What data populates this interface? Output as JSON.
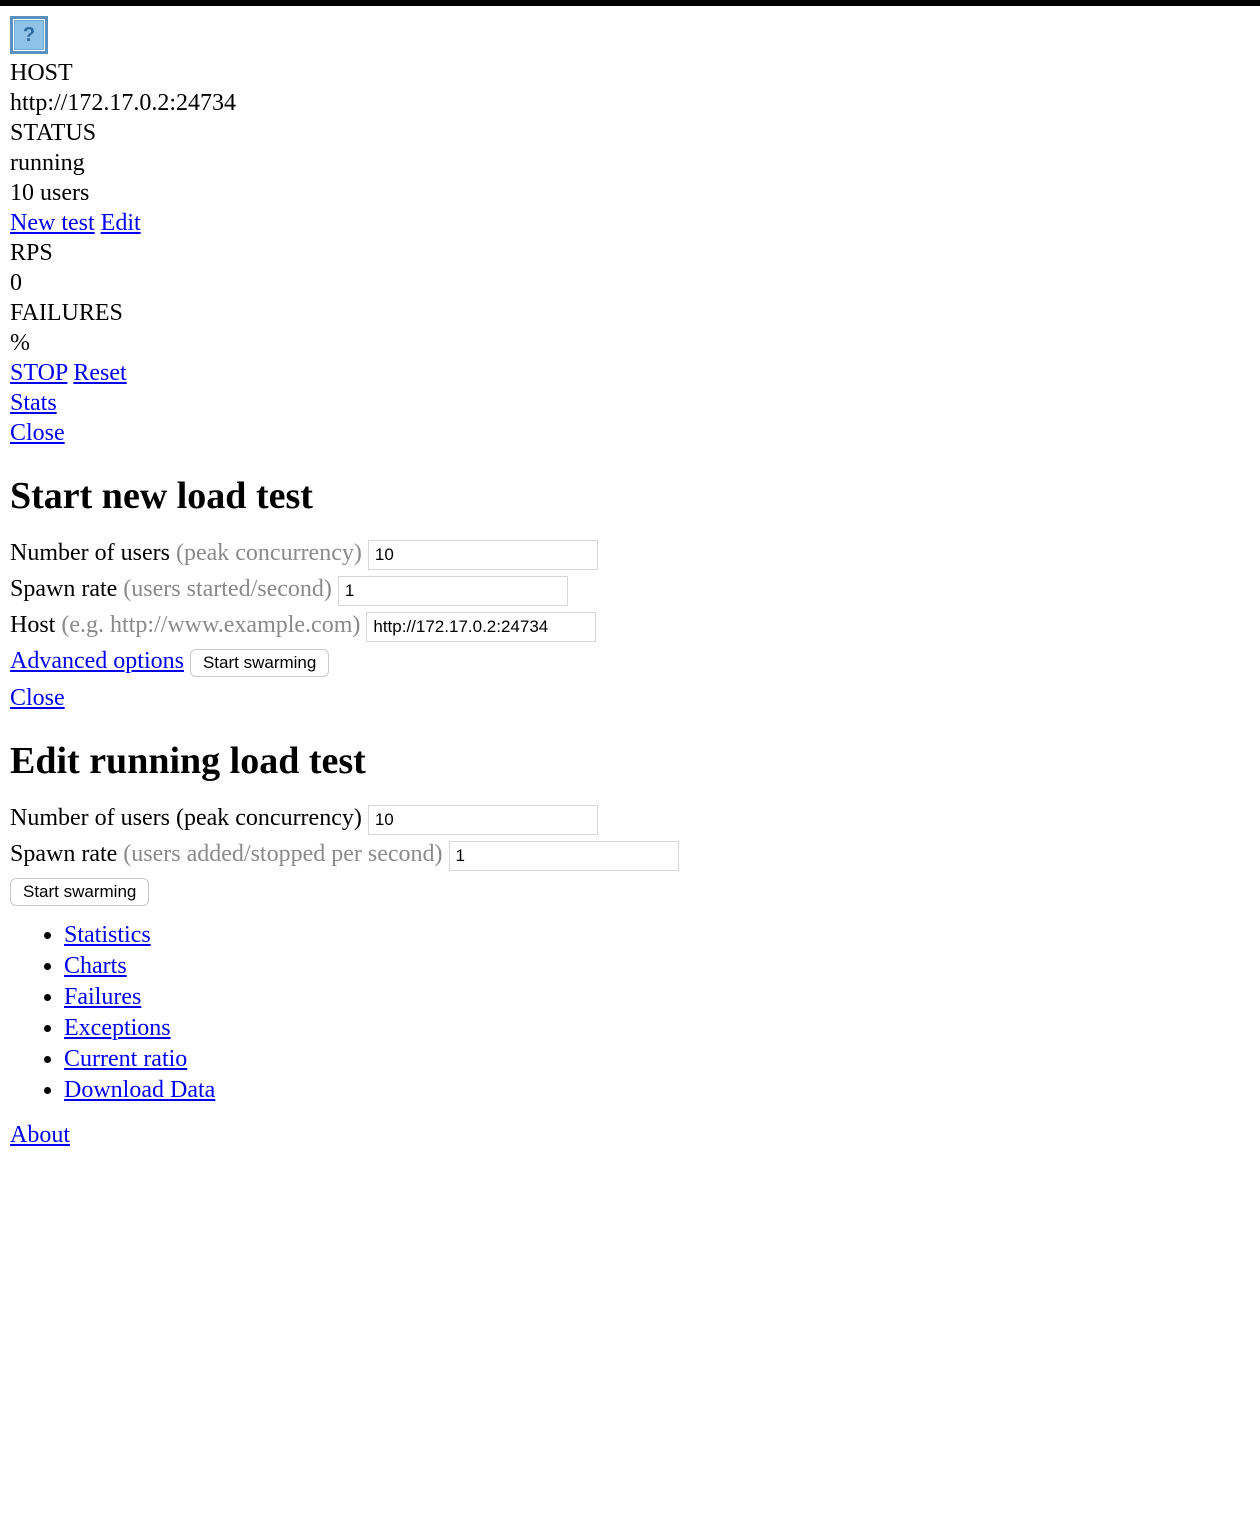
{
  "topbar": {
    "icon_glyph": "?"
  },
  "status": {
    "host_label": "HOST",
    "host_value": "http://172.17.0.2:24734",
    "status_label": "STATUS",
    "status_value": "running",
    "users_value": "10 users",
    "new_test_link": "New test",
    "edit_link": "Edit",
    "rps_label": "RPS",
    "rps_value": "0",
    "failures_label": "FAILURES",
    "failures_value": "%",
    "stop_link": "STOP",
    "reset_link": "Reset",
    "stats_link": "Stats",
    "close_link": "Close"
  },
  "new_test": {
    "heading": "Start new load test",
    "users_label": "Number of users ",
    "users_hint": "(peak concurrency)",
    "users_value": "10",
    "spawn_label": "Spawn rate ",
    "spawn_hint": "(users started/second)",
    "spawn_value": "1",
    "host_label": "Host ",
    "host_hint": "(e.g. http://www.example.com)",
    "host_value": "http://172.17.0.2:24734",
    "advanced_link": "Advanced options",
    "submit_label": "Start swarming",
    "close_link": "Close"
  },
  "edit_test": {
    "heading": "Edit running load test",
    "users_label": "Number of users (peak concurrency)",
    "users_value": "10",
    "spawn_label": "Spawn rate ",
    "spawn_hint": "(users added/stopped per second)",
    "spawn_value": "1",
    "submit_label": "Start swarming"
  },
  "tabs": [
    "Statistics",
    "Charts",
    "Failures",
    "Exceptions",
    "Current ratio",
    "Download Data"
  ],
  "footer": {
    "about_link": "About"
  }
}
